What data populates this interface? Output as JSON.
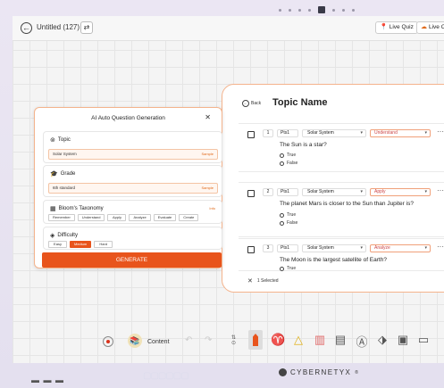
{
  "top_pager": {
    "dots": 8,
    "active_index": 4
  },
  "app": {
    "title": "Untitled (127)",
    "live_quiz": "Live Quiz",
    "live_c": "Live C"
  },
  "topic": {
    "back": "Back",
    "title": "Topic Name"
  },
  "questions": [
    {
      "num": "1",
      "pts": "Pts1",
      "topic": "Solar System",
      "bloom": "Understand",
      "text": "The Sun is a star?",
      "options": [
        "True",
        "False"
      ]
    },
    {
      "num": "2",
      "pts": "Pts1",
      "topic": "Solar System",
      "bloom": "Apply",
      "text": "The planet Mars is closer to the Sun than Jupiter is?",
      "options": [
        "True",
        "False"
      ]
    },
    {
      "num": "3",
      "pts": "Pts1",
      "topic": "Solar System",
      "bloom": "Analyze",
      "text": "The Moon is the largest satellite of Earth?",
      "options": [
        "True"
      ]
    }
  ],
  "selection": {
    "close": "✕",
    "label": "1 Selected"
  },
  "ai_dialog": {
    "title": "AI Auto Question Generation",
    "close": "✕",
    "topic_label": "Topic",
    "topic_value": "Solar System",
    "topic_link": "Sample",
    "grade_label": "Grade",
    "grade_value": "6th standard",
    "grade_link": "Sample",
    "bloom_label": "Bloom's Taxonomy",
    "bloom_info": "Info",
    "bloom_options": [
      "Remember",
      "Understand",
      "Apply",
      "Analyze",
      "Evaluate",
      "Create"
    ],
    "difficulty_label": "Difficulty",
    "difficulty_options": [
      "Easy",
      "Medium",
      "Hard"
    ],
    "difficulty_selected": "Medium",
    "generate": "GENERATE"
  },
  "toolbar": {
    "content": "Content",
    "undo": "↶",
    "redo": "↷"
  },
  "footer": {
    "dash": "▬ ▬ ▬",
    "brand": "CYBERNETYX",
    "brand_mark": "®"
  },
  "colors": {
    "accent": "#e8541c",
    "accent_border": "#f4b38c"
  },
  "icons": [
    "back-icon",
    "swap-icon",
    "pin-icon",
    "close-icon",
    "checkbox-icon",
    "more-icon",
    "topic-icon",
    "grade-icon",
    "bloom-icon",
    "difficulty-icon",
    "record-icon",
    "content-icon",
    "undo-icon",
    "redo-icon",
    "pen-icon",
    "eraser-icon",
    "shape-icon",
    "highlighter-icon",
    "text-icon",
    "calculator-icon"
  ]
}
